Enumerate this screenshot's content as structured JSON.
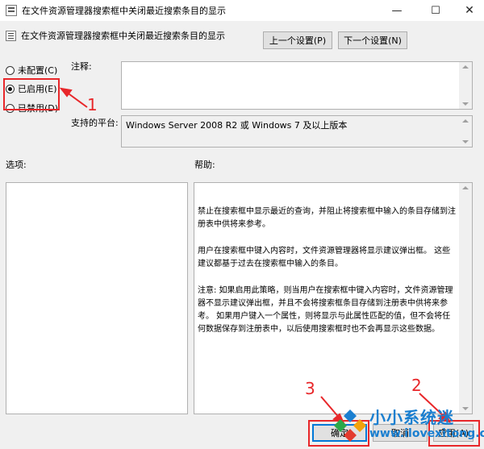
{
  "window": {
    "title": "在文件资源管理器搜索框中关闭最近搜索条目的显示",
    "controls": {
      "minimize": "—",
      "maximize": "☐",
      "close": "✕"
    }
  },
  "header": {
    "policy_title": "在文件资源管理器搜索框中关闭最近搜索条目的显示",
    "prev_button": "上一个设置(P)",
    "next_button": "下一个设置(N)"
  },
  "state_options": [
    {
      "label": "未配置(C)",
      "checked": false
    },
    {
      "label": "已启用(E)",
      "checked": true
    },
    {
      "label": "已禁用(D)",
      "checked": false
    }
  ],
  "comment": {
    "label": "注释:",
    "value": ""
  },
  "platform": {
    "label": "支持的平台:",
    "value": "Windows Server 2008 R2 或 Windows 7 及以上版本"
  },
  "options": {
    "label": "选项:"
  },
  "help": {
    "label": "帮助:",
    "paragraphs": [
      "禁止在搜索框中显示最近的查询，并阻止将搜索框中输入的条目存储到注册表中供将来参考。",
      "用户在搜索框中键入内容时，文件资源管理器将显示建议弹出框。 这些建议都基于过去在搜索框中输入的条目。",
      "注意: 如果启用此策略，则当用户在搜索框中键入内容时，文件资源管理器不显示建议弹出框，并且不会将搜索框条目存储到注册表中供将来参考。 如果用户键入一个属性，则将显示与此属性匹配的值，但不会将任何数据保存到注册表中，以后使用搜索框时也不会再显示这些数据。"
    ]
  },
  "footer": {
    "ok_button": "确定",
    "cancel_button": "取消",
    "apply_button": "应用(A)"
  },
  "annotations": {
    "one": "1",
    "two": "2",
    "three": "3",
    "color": "#e8272a"
  },
  "watermark": {
    "text": "小小系统迷",
    "url": "www.ilovexitong.com",
    "color": "#1a7fd0"
  }
}
